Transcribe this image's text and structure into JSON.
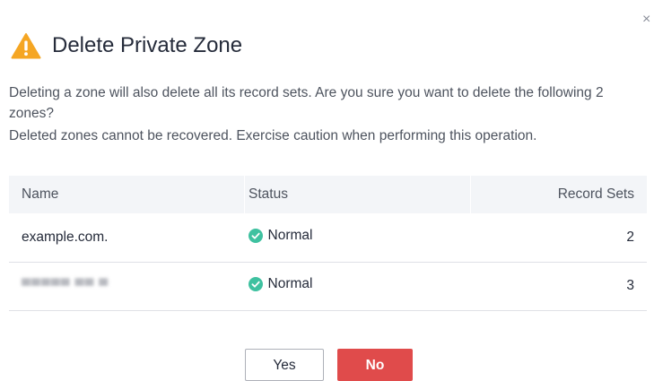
{
  "dialog": {
    "title": "Delete Private Zone",
    "close_glyph": "×",
    "icons": {
      "title": "warning-triangle-icon",
      "close": "close-icon",
      "status": "check-circle-icon"
    },
    "message_line1": "Deleting a zone will also delete all its record sets. Are you sure you want to delete the following 2 zones?",
    "message_line2": "Deleted zones cannot be recovered. Exercise caution when performing this operation.",
    "table": {
      "headers": {
        "name": "Name",
        "status": "Status",
        "record_sets": "Record Sets"
      },
      "rows": [
        {
          "name": "example.com.",
          "status": "Normal",
          "record_sets": "2"
        },
        {
          "name": "▀▀▀▀▀ ▀▀ ▀",
          "status": "Normal",
          "record_sets": "3"
        }
      ]
    },
    "buttons": {
      "yes": "Yes",
      "no": "No"
    },
    "colors": {
      "warning": "#f5a623",
      "status_ok": "#3ec1a0",
      "danger_button": "#e04b4b",
      "table_header_bg": "#f3f5f8"
    }
  }
}
